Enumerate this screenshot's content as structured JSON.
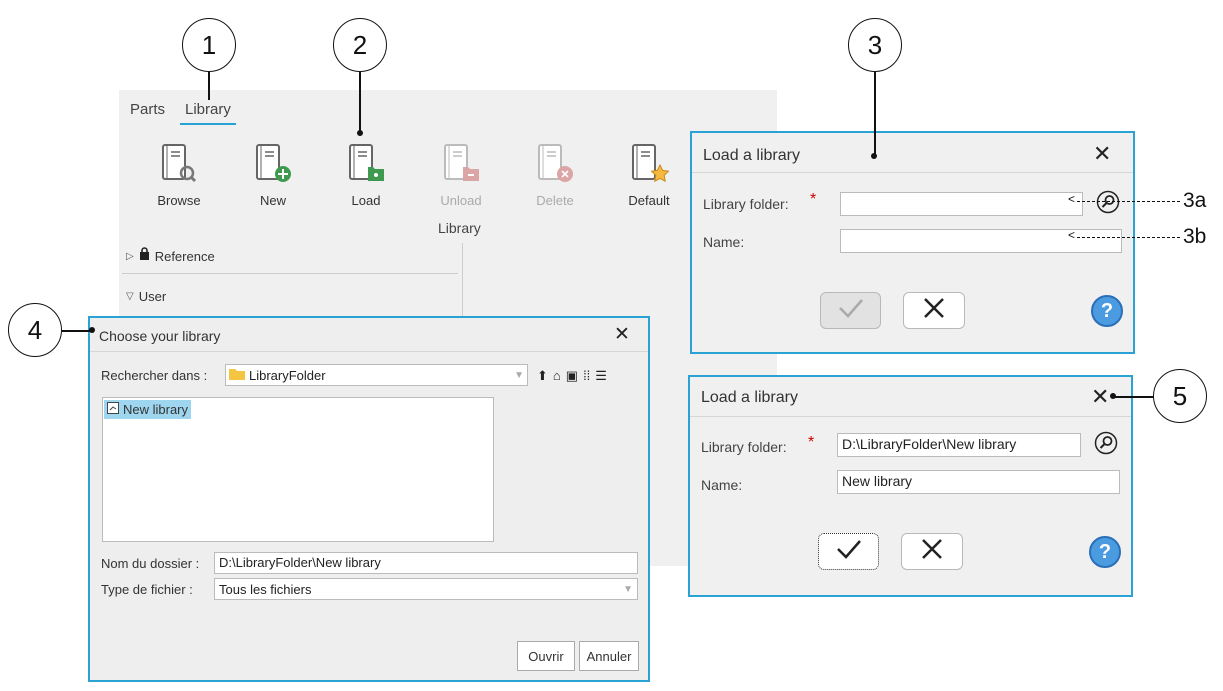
{
  "callouts": {
    "c1": "1",
    "c2": "2",
    "c3": "3",
    "c4": "4",
    "c5": "5",
    "c3a": "3a",
    "c3b": "3b"
  },
  "tabs": [
    {
      "label": "Parts"
    },
    {
      "label": "Library",
      "active": true
    }
  ],
  "toolbar": {
    "items": [
      {
        "label": "Browse",
        "icon": "book-search-icon",
        "enabled": true
      },
      {
        "label": "New",
        "icon": "book-add-icon",
        "enabled": true
      },
      {
        "label": "Load",
        "icon": "book-load-icon",
        "enabled": true
      },
      {
        "label": "Unload",
        "icon": "book-unload-icon",
        "enabled": false
      },
      {
        "label": "Delete",
        "icon": "book-delete-icon",
        "enabled": false
      },
      {
        "label": "Default",
        "icon": "book-star-icon",
        "enabled": true
      }
    ],
    "group_label": "Library"
  },
  "tree": {
    "reference": "Reference",
    "user": "User"
  },
  "load_dialog_empty": {
    "title": "Load a library",
    "folder_label": "Library folder:",
    "required": "*",
    "folder_value": "",
    "name_label": "Name:",
    "name_value": ""
  },
  "load_dialog_filled": {
    "title": "Load a library",
    "folder_label": "Library folder:",
    "required": "*",
    "folder_value": "D:\\LibraryFolder\\New library",
    "name_label": "Name:",
    "name_value": "New library"
  },
  "chooser": {
    "title": "Choose your library",
    "look_in_label": "Rechercher dans :",
    "look_in_value": "LibraryFolder",
    "files": [
      "New library"
    ],
    "folder_name_label": "Nom du dossier :",
    "folder_name_value": "D:\\LibraryFolder\\New library",
    "file_type_label": "Type de fichier :",
    "file_type_value": "Tous les fichiers",
    "open": "Ouvrir",
    "cancel": "Annuler"
  },
  "colors": {
    "accent": "#2aa3d4",
    "required": "#cc0000",
    "help": "#4a9be0"
  }
}
